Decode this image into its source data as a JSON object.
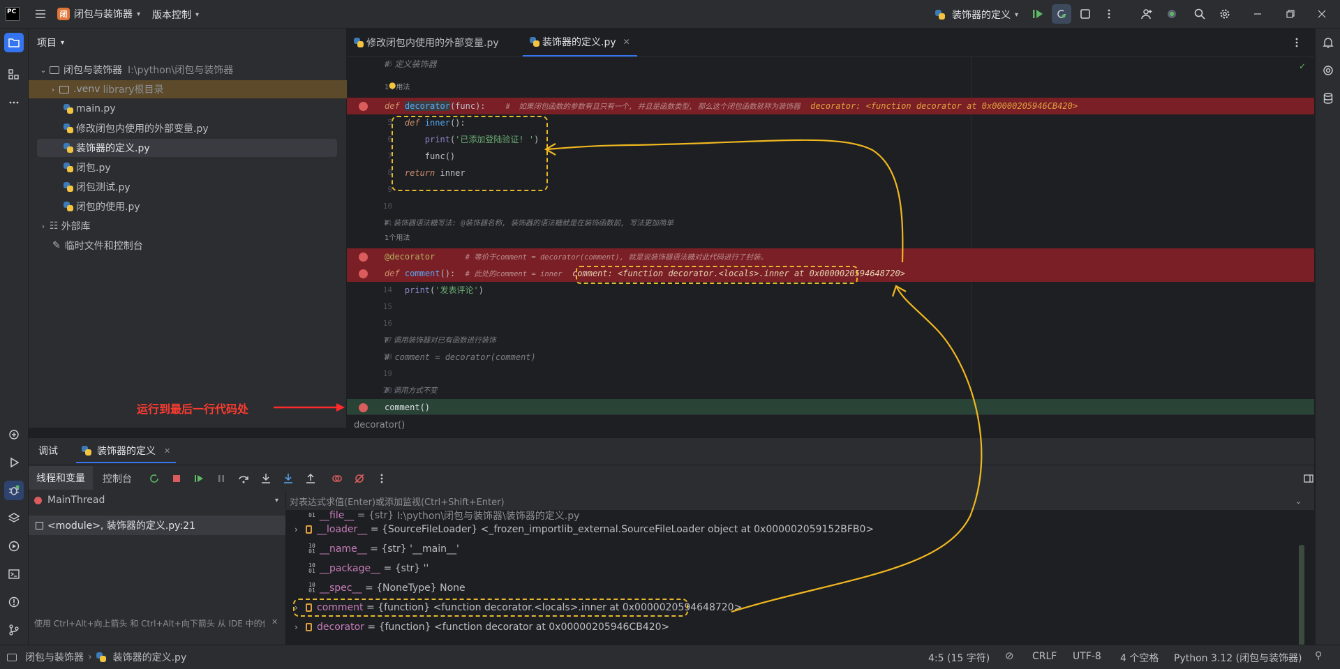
{
  "titlebar": {
    "project_name": "闭包与装饰器",
    "project_badge": "闭",
    "vcs_label": "版本控制",
    "run_config": "装饰器的定义"
  },
  "project_panel": {
    "title": "项目",
    "tree": [
      {
        "label": "闭包与装饰器",
        "hint": "I:\\python\\闭包与装饰器"
      },
      {
        "label": ".venv",
        "hint": "library根目录"
      },
      {
        "label": "main.py"
      },
      {
        "label": "修改闭包内使用的外部变量.py"
      },
      {
        "label": "装饰器的定义.py"
      },
      {
        "label": "闭包.py"
      },
      {
        "label": "闭包测试.py"
      },
      {
        "label": "闭包的使用.py"
      },
      {
        "label": "外部库"
      },
      {
        "label": "临时文件和控制台"
      }
    ]
  },
  "tabs": [
    {
      "label": "修改闭包内使用的外部变量.py"
    },
    {
      "label": "装饰器的定义.py"
    }
  ],
  "editor": {
    "lines": [
      {
        "n": "3",
        "text": "# 定义装饰器"
      },
      {
        "usages": "1个用法"
      },
      {
        "n": "",
        "kw": "def",
        "fn": "decorator",
        "rest": "(func):",
        "comment": "#  如果闭包函数的参数有且只有一个, 并且是函数类型, 那么这个闭包函数就称为装饰器",
        "inline": "decorator: <function decorator at 0x00000205946CB420>"
      },
      {
        "n": "5",
        "kw": "def",
        "fn": "inner",
        "rest": "():"
      },
      {
        "n": "6",
        "fn": "print",
        "str": "'已添加登陆验证! '"
      },
      {
        "n": "7",
        "text": "func()"
      },
      {
        "n": "8",
        "kw": "return",
        "rest": " inner"
      },
      {
        "n": "9"
      },
      {
        "n": "10"
      },
      {
        "n": "11",
        "comment": "# 装饰器语法糖写法: @装饰器名称, 装饰器的语法糖就是在装饰函数前, 写法更加简单"
      },
      {
        "usages": "1个用法"
      },
      {
        "n": "",
        "deco": "@decorator",
        "comment": "# 等价于comment = decorator(comment), 就是说装饰器语法糖对此代码进行了封装。"
      },
      {
        "n": "",
        "kw": "def",
        "fn": "comment",
        "rest": "():",
        "comment": "# 此处的comment = inner",
        "inline": "comment: <function decorator.<locals>.inner at 0x0000020594648720>"
      },
      {
        "n": "14",
        "fn": "print",
        "str": "'发表评论'"
      },
      {
        "n": "15"
      },
      {
        "n": "16"
      },
      {
        "n": "17",
        "comment": "# 调用装饰器对已有函数进行装饰"
      },
      {
        "n": "18",
        "comment": "# comment = decorator(comment)"
      },
      {
        "n": "19"
      },
      {
        "n": "20",
        "comment": "# 调用方式不变"
      },
      {
        "n": "",
        "text": "comment()"
      }
    ],
    "breadcrumb": "decorator()",
    "annotation": "运行到最后一行代码处"
  },
  "debug": {
    "tab_debug": "调试",
    "session": "装饰器的定义",
    "tab_threads": "线程和变量",
    "tab_console": "控制台",
    "thread": "MainThread",
    "frame": "<module>, 装饰器的定义.py:21",
    "eval_placeholder": "对表达式求值(Enter)或添加监视(Ctrl+Shift+Enter)",
    "hint": "使用 Ctrl+Alt+向上箭头 和 Ctrl+Alt+向下箭头 从 IDE 中的任...",
    "variables": [
      {
        "name": "__file__",
        "type": "{str}",
        "value": "I:\\python\\闭包与装饰器\\装饰器的定义.py"
      },
      {
        "name": "__loader__",
        "type": "{SourceFileLoader}",
        "value": "<_frozen_importlib_external.SourceFileLoader object at 0x000002059152BFB0>"
      },
      {
        "name": "__name__",
        "type": "{str}",
        "value": "'__main__'"
      },
      {
        "name": "__package__",
        "type": "{str}",
        "value": "''"
      },
      {
        "name": "__spec__",
        "type": "{NoneType}",
        "value": "None"
      },
      {
        "name": "comment",
        "type": "{function}",
        "value": "<function decorator.<locals>.inner at 0x0000020594648720>"
      },
      {
        "name": "decorator",
        "type": "{function}",
        "value": "<function decorator at 0x00000205946CB420>"
      }
    ]
  },
  "statusbar": {
    "path_project": "闭包与装饰器",
    "path_file": "装饰器的定义.py",
    "position": "4:5 (15 字符)",
    "line_sep": "CRLF",
    "encoding": "UTF-8",
    "indent": "4 个空格",
    "interpreter": "Python 3.12 (闭包与装饰器)"
  }
}
